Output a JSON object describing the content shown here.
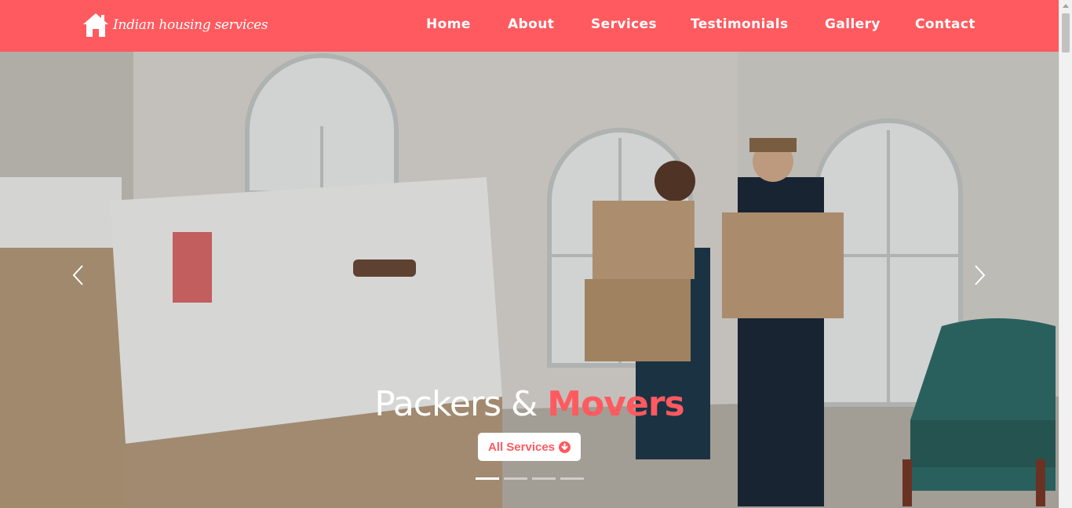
{
  "brand": {
    "name": "Indian housing services",
    "icon": "house-icon"
  },
  "nav": {
    "items": [
      {
        "label": "Home"
      },
      {
        "label": "About"
      },
      {
        "label": "Services"
      },
      {
        "label": "Testimonials"
      },
      {
        "label": "Gallery"
      },
      {
        "label": "Contact"
      }
    ]
  },
  "hero": {
    "headline_part1": "Packers & ",
    "headline_part2": "Movers",
    "button_label": "All Services",
    "button_icon": "arrow-circle-down-icon",
    "slides_count": 4,
    "active_slide": 1
  },
  "colors": {
    "accent": "#ff5a5f",
    "white": "#ffffff"
  }
}
